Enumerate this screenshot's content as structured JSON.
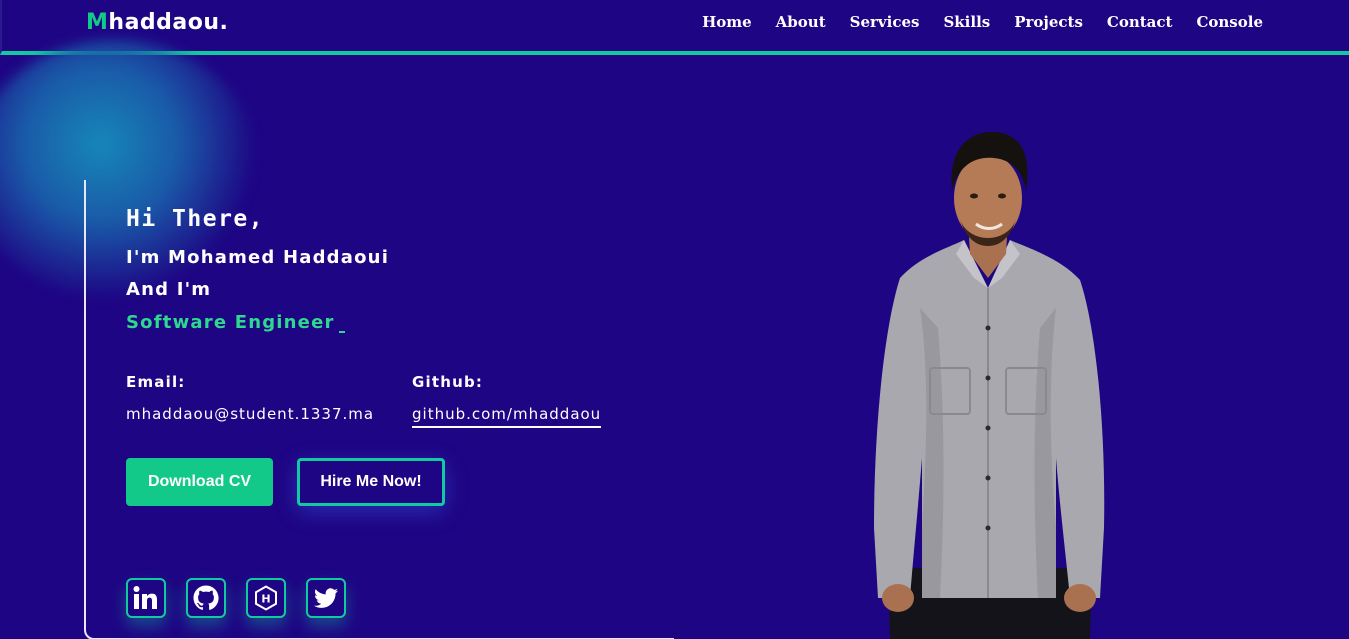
{
  "header": {
    "logo_initial": "M",
    "logo_rest": "haddaou.",
    "nav": [
      "Home",
      "About",
      "Services",
      "Skills",
      "Projects",
      "Contact",
      "Console"
    ]
  },
  "hero": {
    "greeting": "Hi There,",
    "name_line": "I'm Mohamed Haddaoui",
    "and_line": "And I'm",
    "role": "Software Engineer",
    "email_label": "Email:",
    "email_value": "mhaddaou@student.1337.ma",
    "github_label": "Github:",
    "github_value": "github.com/mhaddaou",
    "download_cv": "Download CV",
    "hire_me": "Hire Me Now!"
  },
  "socials": [
    "linkedin-icon",
    "github-icon",
    "hashnode-icon",
    "twitter-icon"
  ],
  "colors": {
    "background": "#1e0584",
    "accent": "#13c98a",
    "accent_border": "#13c9a0",
    "role_text": "#2fd88f"
  }
}
